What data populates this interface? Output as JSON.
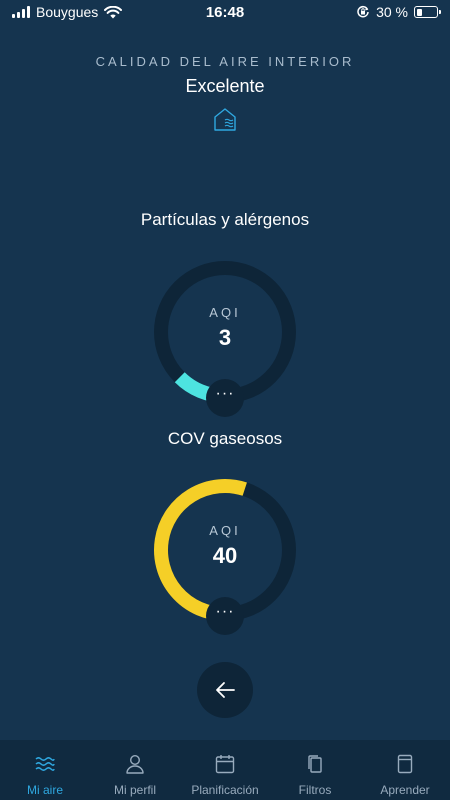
{
  "status_bar": {
    "carrier": "Bouygues",
    "time": "16:48",
    "battery_text": "30 %",
    "battery_level": 0.3
  },
  "header": {
    "subtitle": "CALIDAD DEL AIRE INTERIOR",
    "status": "Excelente",
    "icon": "house-air-icon"
  },
  "gauges": [
    {
      "title": "Partículas y alérgenos",
      "label": "AQI",
      "value": "3",
      "fill_fraction": 0.125,
      "color": "#4de3e0",
      "more": "···"
    },
    {
      "title": "COV gaseosos",
      "label": "AQI",
      "value": "40",
      "fill_fraction": 0.55,
      "color": "#f5cf27",
      "more": "···"
    }
  ],
  "colors": {
    "background": "#15344f",
    "track": "#0e2538",
    "accent": "#2fa8e0"
  },
  "bottom_nav": [
    {
      "label": "Mi aire",
      "icon": "waves-icon",
      "active": true
    },
    {
      "label": "Mi perfil",
      "icon": "user-icon",
      "active": false
    },
    {
      "label": "Planificación",
      "icon": "calendar-icon",
      "active": false
    },
    {
      "label": "Filtros",
      "icon": "filters-icon",
      "active": false
    },
    {
      "label": "Aprender",
      "icon": "book-icon",
      "active": false
    }
  ]
}
